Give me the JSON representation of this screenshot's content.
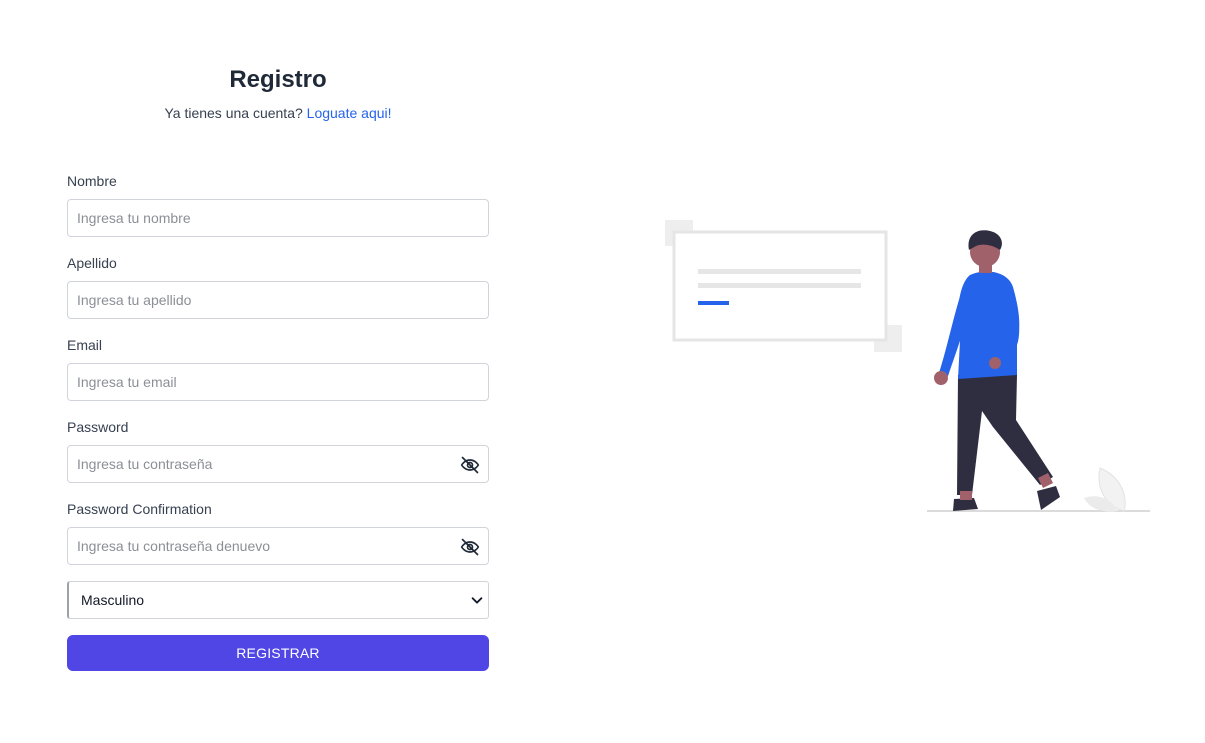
{
  "header": {
    "title": "Registro",
    "subtitle_prefix": "Ya tienes una cuenta?",
    "login_link": "Loguate aqui!"
  },
  "form": {
    "nombre": {
      "label": "Nombre",
      "placeholder": "Ingresa tu nombre"
    },
    "apellido": {
      "label": "Apellido",
      "placeholder": "Ingresa tu apellido"
    },
    "email": {
      "label": "Email",
      "placeholder": "Ingresa tu email"
    },
    "password": {
      "label": "Password",
      "placeholder": "Ingresa tu contraseña",
      "icon": "eye-off-icon"
    },
    "password_confirmation": {
      "label": "Password Confirmation",
      "placeholder": "Ingresa tu contraseña denuevo",
      "icon": "eye-off-icon"
    },
    "gender": {
      "selected": "Masculino",
      "icon": "chevron-down-icon"
    },
    "submit_label": "REGISTRAR"
  },
  "colors": {
    "primary_button": "#4f46e5",
    "link": "#2563eb",
    "illustration_accent": "#2563eb"
  }
}
